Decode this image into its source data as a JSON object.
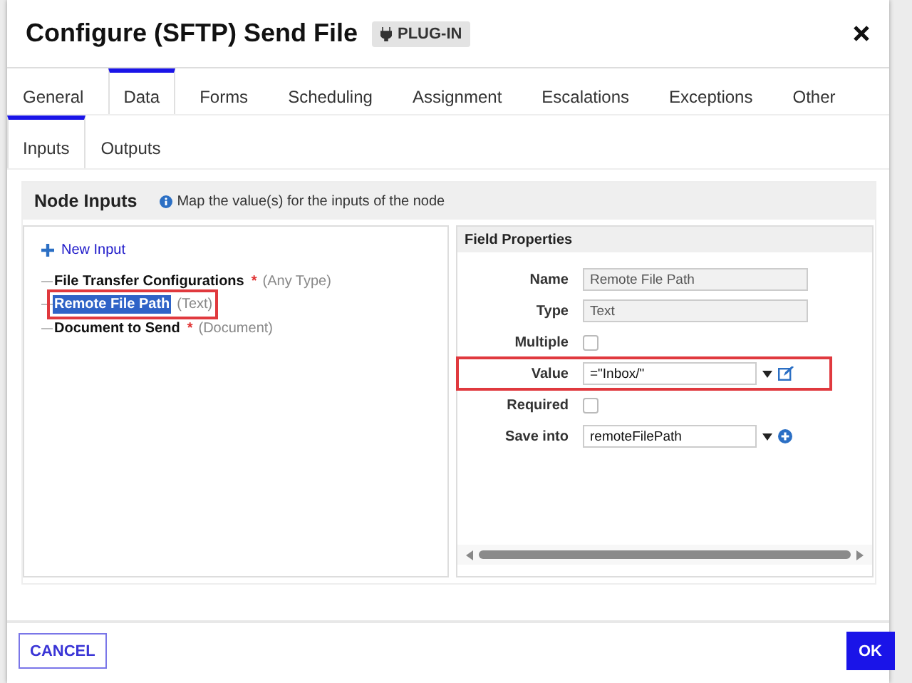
{
  "dialog": {
    "title": "Configure (SFTP) Send File",
    "badge": "PLUG-IN"
  },
  "tabs": [
    {
      "label": "General",
      "selected": false
    },
    {
      "label": "Data",
      "selected": true
    },
    {
      "label": "Forms",
      "selected": false
    },
    {
      "label": "Scheduling",
      "selected": false
    },
    {
      "label": "Assignment",
      "selected": false
    },
    {
      "label": "Escalations",
      "selected": false
    },
    {
      "label": "Exceptions",
      "selected": false
    },
    {
      "label": "Other",
      "selected": false
    }
  ],
  "subtabs": [
    {
      "label": "Inputs",
      "selected": true
    },
    {
      "label": "Outputs",
      "selected": false
    }
  ],
  "node_inputs": {
    "title": "Node Inputs",
    "hint": "Map the value(s) for the inputs of the node"
  },
  "tree": {
    "new_input": "New Input",
    "items": [
      {
        "name": "File Transfer Configurations",
        "required_mark": "*",
        "type": "(Any Type)",
        "selected": false,
        "highlighted": false
      },
      {
        "name": "Remote File Path",
        "type": "(Text)",
        "selected": true,
        "highlighted": true
      },
      {
        "name": "Document to Send",
        "required_mark": "*",
        "type": "(Document)",
        "selected": false,
        "highlighted": false
      }
    ]
  },
  "field_properties": {
    "title": "Field Properties",
    "rows": [
      {
        "kind": "text",
        "label": "Name",
        "value": "Remote File Path",
        "disabled": true
      },
      {
        "kind": "text",
        "label": "Type",
        "value": "Text",
        "disabled": true
      },
      {
        "kind": "checkbox",
        "label": "Multiple",
        "checked": false
      },
      {
        "kind": "select",
        "label": "Value",
        "value": "=\"Inbox/\"",
        "edit_button": true,
        "highlighted": true
      },
      {
        "kind": "checkbox",
        "label": "Required",
        "checked": false
      },
      {
        "kind": "select",
        "label": "Save into",
        "value": "remoteFilePath",
        "add_button": true,
        "highlighted": false
      }
    ]
  },
  "buttons": [
    {
      "label": "CANCEL",
      "kind": "secondary"
    },
    {
      "label": "OK",
      "kind": "primary"
    }
  ]
}
